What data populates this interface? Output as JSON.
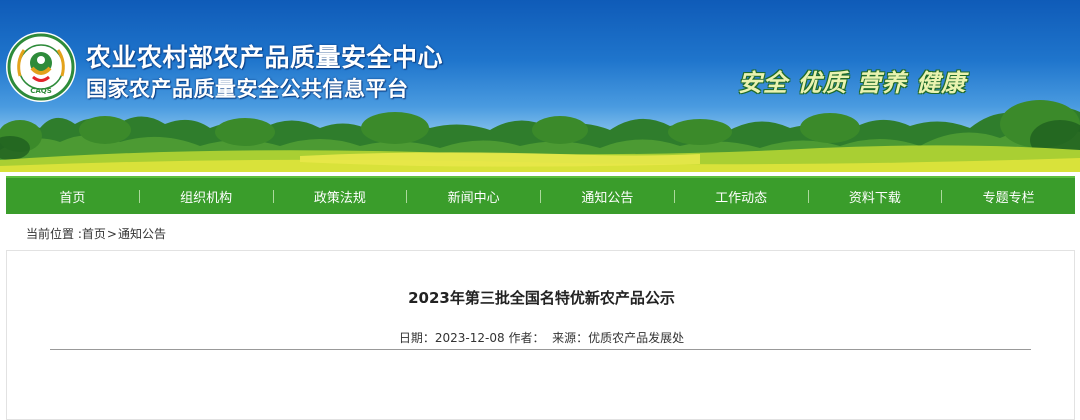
{
  "header": {
    "org_title": "农业农村部农产品质量安全中心",
    "org_subtitle": "国家农产品质量安全公共信息平台",
    "slogan": "安全 优质 营养 健康",
    "logo": {
      "icon": "caqs-logo-icon",
      "ring_text": "安全 优质 营养 健康",
      "abbr": "CAQS"
    }
  },
  "nav": {
    "items": [
      {
        "label": "首页"
      },
      {
        "label": "组织机构"
      },
      {
        "label": "政策法规"
      },
      {
        "label": "新闻中心"
      },
      {
        "label": "通知公告"
      },
      {
        "label": "工作动态"
      },
      {
        "label": "资料下载"
      },
      {
        "label": "专题专栏"
      }
    ],
    "color": "#3a9d2b"
  },
  "breadcrumb": {
    "prefix": "当前位置 :",
    "home": "首页",
    "separator": ">",
    "current": "通知公告"
  },
  "article": {
    "title": "2023年第三批全国名特优新农产品公示",
    "date_label": "日期：",
    "date": "2023-12-08",
    "author_label": " 作者：",
    "source_label": "  来源：",
    "source": "优质农产品发展处"
  }
}
